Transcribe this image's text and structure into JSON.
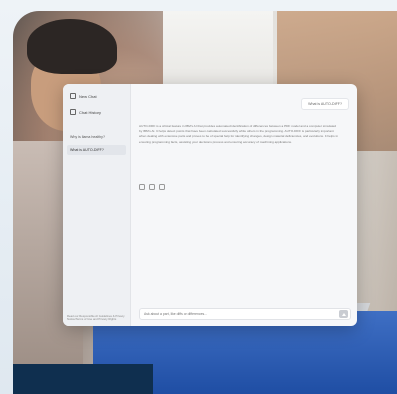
{
  "sidebar": {
    "new_chat_label": "New Chat",
    "chat_history_label": "Chat History",
    "items": [
      {
        "label": "Why is llama healthy?"
      },
      {
        "label": "What is AUTO-DIFF?"
      }
    ],
    "footer_text": "Read our Responsible AI Guidelines & Privacy Notice/Terms of Use and Privacy Rights"
  },
  "conversation": {
    "user_message": "What is AUTO-DIFF?",
    "assistant_message": "AUTO-DIFF is a critical feature in IBM's AI that provides automated identification of differences between a PDF model and a computer simulated by IBM's AI. It helps detect points that have been calculated successfully while others in the programming. AUTO-DIFF is particularly important when dealing with extensive parts and proves to be of special help for identifying changes, design material deficiencies, and evolutions. It helps in ensuring programming facts, assisting your decisions process and ensuring accuracy of machining applications."
  },
  "composer": {
    "placeholder": "Ask about a part, like diffs or differences..."
  }
}
